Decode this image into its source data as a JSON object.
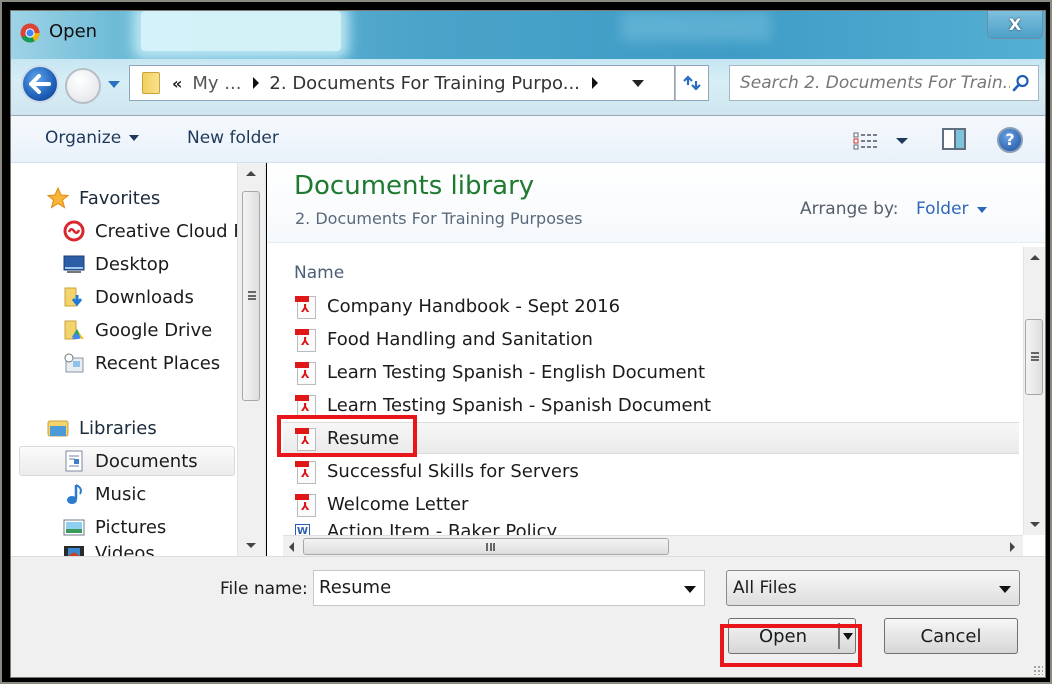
{
  "window": {
    "title": "Open",
    "close_label": "X"
  },
  "address": {
    "overflow_label": "«",
    "crumbs": [
      "My ...",
      "2. Documents For Training Purpo..."
    ],
    "refresh_icon": "refresh-icon"
  },
  "search": {
    "placeholder": "Search 2. Documents For Train..."
  },
  "toolbar": {
    "organize_label": "Organize",
    "new_folder_label": "New folder"
  },
  "nav": {
    "favorites_label": "Favorites",
    "favorites": [
      {
        "label": "Creative Cloud Fi",
        "icon": "creative-cloud-icon"
      },
      {
        "label": "Desktop",
        "icon": "desktop-icon"
      },
      {
        "label": "Downloads",
        "icon": "downloads-icon"
      },
      {
        "label": "Google Drive",
        "icon": "google-drive-icon"
      },
      {
        "label": "Recent Places",
        "icon": "recent-places-icon"
      }
    ],
    "libraries_label": "Libraries",
    "libraries": [
      {
        "label": "Documents",
        "icon": "documents-icon",
        "selected": true
      },
      {
        "label": "Music",
        "icon": "music-icon"
      },
      {
        "label": "Pictures",
        "icon": "pictures-icon"
      },
      {
        "label": "Videos",
        "icon": "videos-icon"
      }
    ]
  },
  "library": {
    "title": "Documents library",
    "subtitle": "2. Documents For Training Purposes",
    "arrange_label": "Arrange by:",
    "arrange_value": "Folder"
  },
  "files": {
    "column_header": "Name",
    "items": [
      {
        "name": "Company Handbook - Sept 2016",
        "type": "pdf"
      },
      {
        "name": "Food Handling and Sanitation",
        "type": "pdf"
      },
      {
        "name": "Learn Testing Spanish - English Document",
        "type": "pdf"
      },
      {
        "name": "Learn Testing Spanish - Spanish Document",
        "type": "pdf"
      },
      {
        "name": "Resume",
        "type": "pdf",
        "selected": true
      },
      {
        "name": "Successful Skills for Servers",
        "type": "pdf"
      },
      {
        "name": "Welcome Letter",
        "type": "pdf"
      },
      {
        "name": "Action Item - Baker Policy",
        "type": "word"
      }
    ]
  },
  "footer": {
    "file_name_label": "File name:",
    "file_name_value": "Resume",
    "file_type_value": "All Files",
    "open_label": "Open",
    "cancel_label": "Cancel"
  },
  "annotations": {
    "highlight_color": "#e8161b"
  }
}
